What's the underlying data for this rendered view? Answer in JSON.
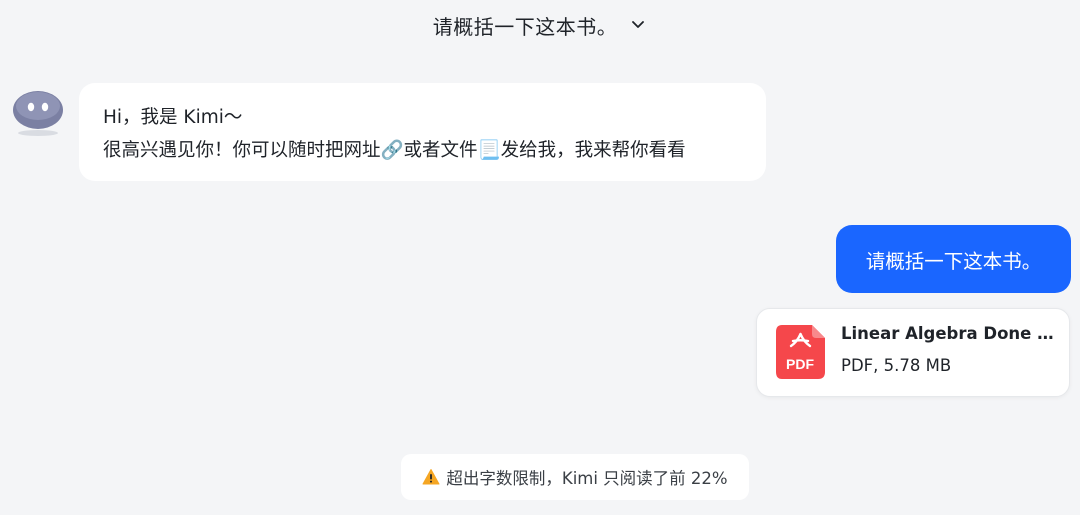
{
  "header": {
    "title": "请概括一下这本书。",
    "dropdown_icon": "chevron-down-icon"
  },
  "bot_message": {
    "avatar_icon": "kimi-bot-avatar",
    "line1": "Hi，我是 Kimi～",
    "line2": "很高兴遇见你！你可以随时把网址🔗或者文件📃发给我，我来帮你看看"
  },
  "user_message": {
    "text": "请概括一下这本书。",
    "bubble_color": "#1a66ff"
  },
  "attachment": {
    "icon": "pdf-icon",
    "icon_label": "PDF",
    "icon_color": "#f5474b",
    "name": "Linear Algebra Done Ri...",
    "meta": "PDF, 5.78 MB"
  },
  "notice": {
    "icon": "warning-icon",
    "text": "超出字数限制，Kimi 只阅读了前 22%"
  }
}
